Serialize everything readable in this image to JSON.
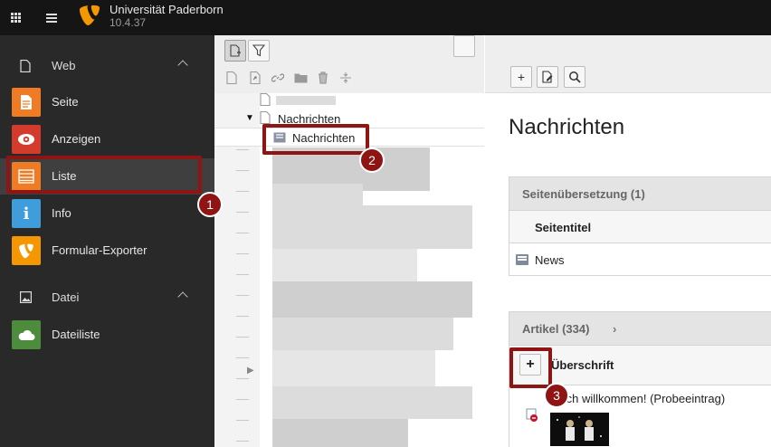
{
  "topbar": {
    "site_title": "Universität Paderborn",
    "version": "10.4.37",
    "logo_color": "#f49700",
    "icons": [
      "module-grid-icon",
      "list-icon",
      "typo3-logo-icon"
    ]
  },
  "modmenu": {
    "sections": [
      {
        "label": "Web",
        "icon": "file-icon"
      },
      {
        "label": "Datei",
        "icon": "image-icon"
      }
    ],
    "items": [
      {
        "label": "Seite",
        "icon": "page-icon",
        "color": "#ef7c24"
      },
      {
        "label": "Anzeigen",
        "icon": "eye-icon",
        "color": "#d33b2d"
      },
      {
        "label": "Liste",
        "icon": "list-module-icon",
        "color": "#ef7c24"
      },
      {
        "label": "Info",
        "icon": "info-icon",
        "color": "#3f9ddb"
      },
      {
        "label": "Formular-Exporter",
        "icon": "typo3-form-icon",
        "color": "#f49700"
      },
      {
        "label": "Dateiliste",
        "icon": "cloud-folder-icon",
        "color": "#4d8c3c"
      }
    ]
  },
  "markers": [
    "1",
    "2",
    "3"
  ],
  "tree": {
    "parent_label": "Nachrichten",
    "selected_label": "Nachrichten"
  },
  "main": {
    "title": "Nachrichten",
    "translation_panel": {
      "header": "Seitenübersetzung (1)",
      "column": "Seitentitel",
      "row": "News"
    },
    "articles_panel": {
      "header": "Artikel (334)",
      "column": "Überschrift",
      "first_row": "rzlich willkommen! (Probeeintrag)"
    }
  },
  "colors": {
    "highlight": "#8f1414",
    "menu_bg": "#292929",
    "topbar_bg": "#151515"
  }
}
